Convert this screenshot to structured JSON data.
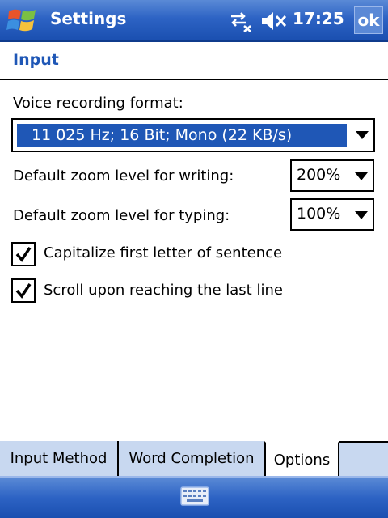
{
  "title_bar": {
    "app_title": "Settings",
    "clock": "17:25",
    "ok_label": "ok",
    "icons": [
      "windows-start-icon",
      "connectivity-off-icon",
      "volume-muted-icon"
    ]
  },
  "page": {
    "title": "Input"
  },
  "voice": {
    "label": "Voice recording format:",
    "value": "11 025 Hz; 16 Bit; Mono (22 KB/s)"
  },
  "zoom_writing": {
    "label": "Default zoom level for writing:",
    "value": "200%"
  },
  "zoom_typing": {
    "label": "Default zoom level for typing:",
    "value": "100%"
  },
  "options": [
    {
      "label": "Capitalize first letter of sentence",
      "checked": true
    },
    {
      "label": "Scroll upon reaching the last line",
      "checked": true
    }
  ],
  "tabs": [
    {
      "label": "Input Method",
      "active": false
    },
    {
      "label": "Word Completion",
      "active": false
    },
    {
      "label": "Options",
      "active": true
    }
  ],
  "bottom_bar": {
    "icons": [
      "keyboard-icon"
    ]
  },
  "colors": {
    "accent": "#1f57b6",
    "titlebar": "#2d63c4",
    "tab_bg": "#c8d8f0"
  }
}
